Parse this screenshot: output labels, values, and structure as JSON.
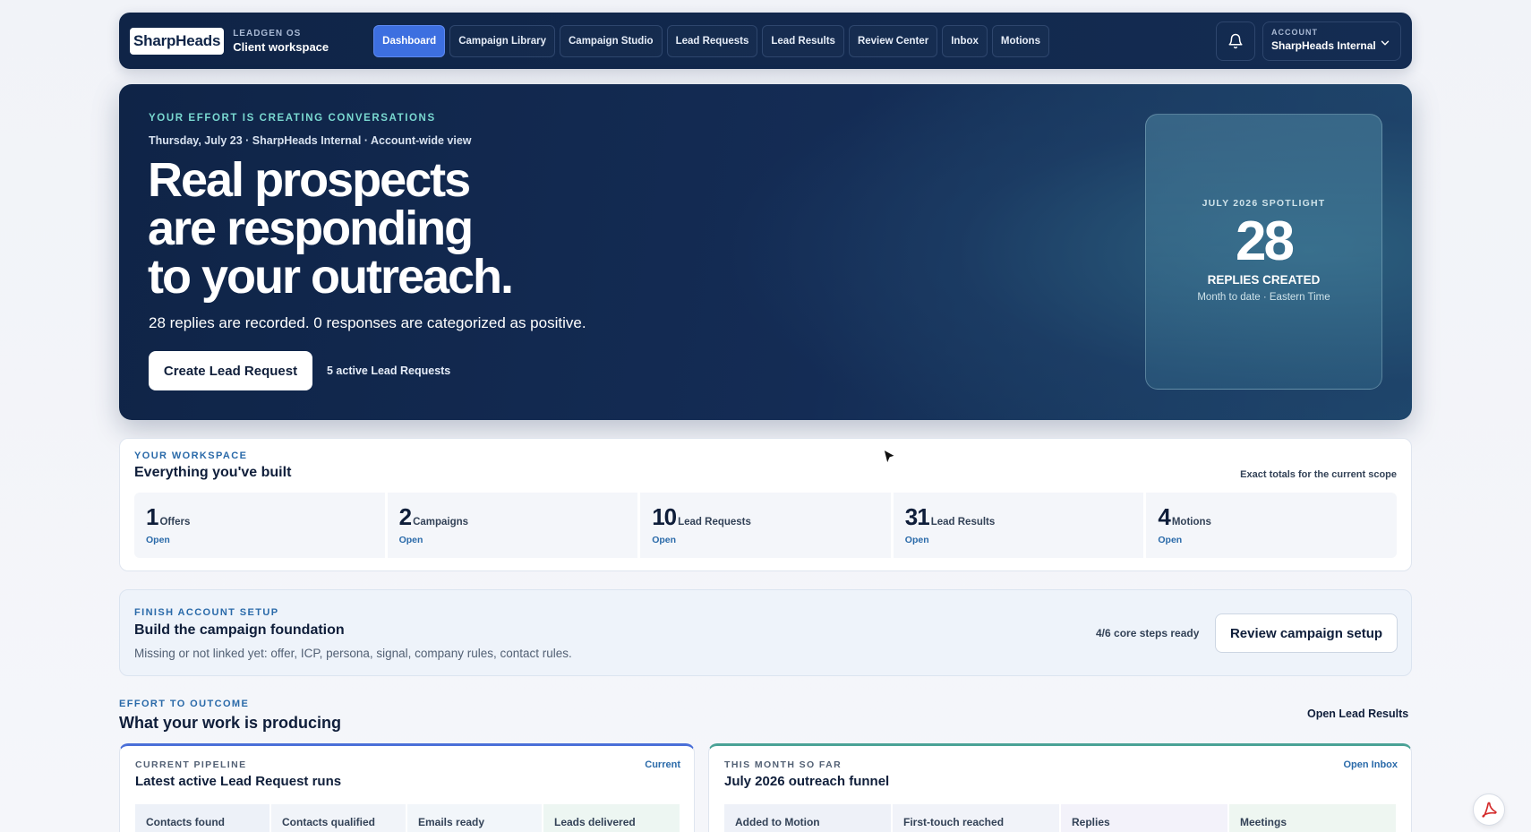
{
  "nav": {
    "logo": "SharpHeads",
    "brand_sub": "LEADGEN OS",
    "brand_main": "Client workspace",
    "tabs": [
      {
        "label": "Dashboard",
        "active": true
      },
      {
        "label": "Campaign Library"
      },
      {
        "label": "Campaign Studio"
      },
      {
        "label": "Lead Requests"
      },
      {
        "label": "Lead Results"
      },
      {
        "label": "Review Center"
      },
      {
        "label": "Inbox"
      },
      {
        "label": "Motions"
      }
    ],
    "bell_icon": "bell-icon",
    "account_label": "ACCOUNT",
    "account_name": "SharpHeads Internal",
    "chevron_icon": "chevron-down-icon"
  },
  "hero": {
    "eyebrow": "YOUR EFFORT IS CREATING CONVERSATIONS",
    "date_line": "Thursday, July 23 · SharpHeads Internal · Account-wide view",
    "title_lines": [
      "Real prospects",
      "are responding",
      "to your outreach."
    ],
    "subtitle": "28 replies are recorded. 0 responses are categorized as positive.",
    "cta": "Create Lead Request",
    "active_count": "5 active Lead Requests",
    "spotlight": {
      "label": "JULY 2026 SPOTLIGHT",
      "value": "28",
      "metric": "REPLIES CREATED",
      "note": "Month to date · Eastern Time"
    }
  },
  "workspace": {
    "eyebrow": "YOUR WORKSPACE",
    "title": "Everything you've built",
    "note": "Exact totals for the current scope",
    "stats": [
      {
        "value": "1",
        "label": "Offers",
        "link": "Open"
      },
      {
        "value": "2",
        "label": "Campaigns",
        "link": "Open"
      },
      {
        "value": "10",
        "label": "Lead Requests",
        "link": "Open"
      },
      {
        "value": "31",
        "label": "Lead Results",
        "link": "Open"
      },
      {
        "value": "4",
        "label": "Motions",
        "link": "Open"
      }
    ]
  },
  "setup": {
    "eyebrow": "FINISH ACCOUNT SETUP",
    "title": "Build the campaign foundation",
    "description": "Missing or not linked yet: offer, ICP, persona, signal, company rules, contact rules.",
    "steps": "4/6 core steps ready",
    "button": "Review campaign setup"
  },
  "effort": {
    "eyebrow": "EFFORT TO OUTCOME",
    "title": "What your work is producing",
    "link": "Open Lead Results",
    "pipeline": {
      "eyebrow": "CURRENT PIPELINE",
      "title": "Latest active Lead Request runs",
      "link": "Current",
      "columns": [
        "Contacts found",
        "Contacts qualified",
        "Emails ready",
        "Leads delivered"
      ]
    },
    "funnel": {
      "eyebrow": "THIS MONTH SO FAR",
      "title": "July 2026 outreach funnel",
      "link": "Open Inbox",
      "columns": [
        "Added to Motion",
        "First-touch reached",
        "Replies",
        "Meetings"
      ]
    }
  },
  "colors": {
    "accent": "#3d6fe0",
    "navy": "#0f2447",
    "teal": "#79d8d0",
    "link": "#2a6aa9"
  },
  "pdf_icon": "pdf-icon",
  "cursor_icon": "mouse-cursor-icon"
}
